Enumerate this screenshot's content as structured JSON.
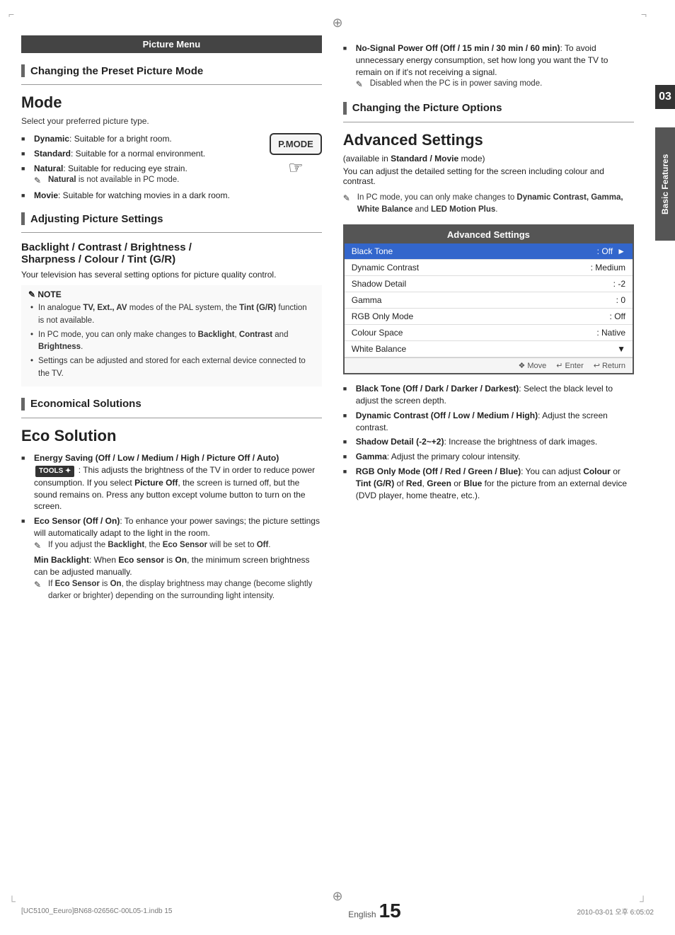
{
  "page": {
    "title": "Picture Menu",
    "footer_file": "[UC5100_Eeuro]BN68-02656C-00L05-1.indb   15",
    "footer_lang": "English",
    "footer_page": "15",
    "footer_date": "2010-03-01   오후 6:05:02"
  },
  "sidebar": {
    "number": "03",
    "label": "Basic Features"
  },
  "left": {
    "picture_menu_header": "Picture Menu",
    "section1_title": "Changing the Preset Picture Mode",
    "mode_title": "Mode",
    "mode_subtitle": "Select your preferred picture type.",
    "mode_items": [
      {
        "name": "Dynamic",
        "desc": ": Suitable for a bright room."
      },
      {
        "name": "Standard",
        "desc": ": Suitable for a normal environment."
      },
      {
        "name": "Natural",
        "desc": ": Suitable for reducing eye strain."
      },
      {
        "name": "Movie",
        "desc": ": Suitable for watching movies in a dark room."
      }
    ],
    "natural_note": "Natural is not available in PC mode.",
    "pmode_label": "P.MODE",
    "section2_title": "Adjusting Picture Settings",
    "backlight_title": "Backlight / Contrast / Brightness /",
    "backlight_title2": "Sharpness / Colour / Tint (G/R)",
    "backlight_desc": "Your television has several setting options for picture quality control.",
    "note_title": "NOTE",
    "note_items": [
      "In analogue TV, Ext., AV modes of the PAL system, the Tint (G/R) function is not available.",
      "In PC mode, you can only make changes to Backlight, Contrast and Brightness.",
      "Settings can be adjusted and stored for each external device connected to the TV."
    ],
    "section3_title": "Economical Solutions",
    "eco_title": "Eco Solution",
    "eco_items": [
      {
        "name": "Energy Saving (Off / Low / Medium / High / Picture Off / Auto)",
        "desc": ": This adjusts the brightness of the TV in order to reduce power consumption. If you select Picture Off, the screen is turned off, but the sound remains on. Press any button except volume button to turn on the screen.",
        "has_tools": true
      },
      {
        "name": "Eco Sensor (Off / On)",
        "desc": ": To enhance your power savings; the picture settings will automatically adapt to the light in the room.",
        "has_tools": false
      }
    ],
    "eco_note1": "If you adjust the Backlight, the Eco Sensor will be set to Off.",
    "eco_min_backlight_title": "Min Backlight",
    "eco_min_backlight_desc": ": When Eco sensor is On, the minimum screen brightness can be adjusted manually.",
    "eco_note2": "If Eco Sensor is On, the display brightness may change (become slightly darker or brighter) depending on the surrounding light intensity."
  },
  "right": {
    "nosignal_title": "No-Signal Power Off (Off / 15 min / 30 min / 60 min)",
    "nosignal_desc": ": To avoid unnecessary energy consumption, set how long you want the TV to remain on if it's not receiving a signal.",
    "nosignal_note": "Disabled when the PC is in power saving mode.",
    "section_title": "Changing the Picture Options",
    "advanced_title": "Advanced Settings",
    "advanced_subtitle": "(available in Standard / Movie mode)",
    "advanced_desc1": "You can adjust the detailed setting for the screen including colour and contrast.",
    "advanced_note": "In PC mode, you can only make changes to Dynamic Contrast, Gamma, White Balance and LED Motion Plus.",
    "table_header": "Advanced Settings",
    "table_rows": [
      {
        "label": "Black Tone",
        "value": ": Off",
        "highlighted": true,
        "arrow": true
      },
      {
        "label": "Dynamic Contrast",
        "value": ": Medium",
        "highlighted": false
      },
      {
        "label": "Shadow Detail",
        "value": ": -2",
        "highlighted": false
      },
      {
        "label": "Gamma",
        "value": ": 0",
        "highlighted": false
      },
      {
        "label": "RGB Only Mode",
        "value": ": Off",
        "highlighted": false
      },
      {
        "label": "Colour Space",
        "value": ": Native",
        "highlighted": false
      },
      {
        "label": "White Balance",
        "value": "",
        "highlighted": false
      }
    ],
    "nav_move": "Move",
    "nav_enter": "Enter",
    "nav_return": "Return",
    "desc_items": [
      {
        "name": "Black Tone (Off / Dark / Darker / Darkest)",
        "desc": ": Select the black level to adjust the screen depth."
      },
      {
        "name": "Dynamic Contrast (Off / Low / Medium / High)",
        "desc": ": Adjust the screen contrast."
      },
      {
        "name": "Shadow Detail (-2~+2)",
        "desc": ": Increase the brightness of dark images."
      },
      {
        "name": "Gamma",
        "desc": ": Adjust the primary colour intensity."
      },
      {
        "name": "RGB Only Mode (Off / Red / Green / Blue)",
        "desc": ": You can adjust Colour or Tint (G/R) of Red, Green or Blue for the picture from an external device (DVD player, home theatre, etc.)."
      }
    ]
  }
}
